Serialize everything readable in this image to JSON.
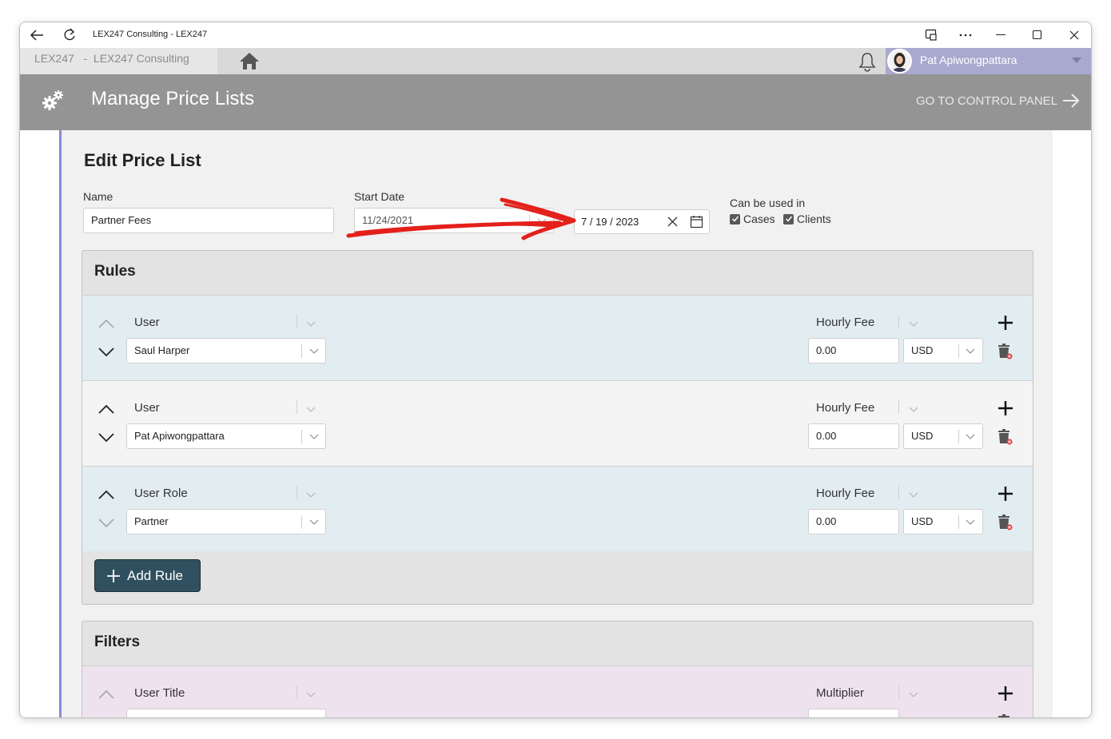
{
  "window": {
    "title": "LEX247 Consulting - LEX247"
  },
  "appbar": {
    "breadcrumb": "LEX247   -  LEX247 Consulting",
    "user_name": "Pat Apiwongpattara"
  },
  "header": {
    "title": "Manage Price Lists",
    "control_panel_link": "GO TO CONTROL PANEL"
  },
  "form": {
    "title": "Edit Price List",
    "name_label": "Name",
    "name_value": "Partner Fees",
    "start_date_label": "Start Date",
    "start_date_value": "11/24/2021",
    "end_date_value": "7 / 19 / 2023",
    "usage_label": "Can be used in",
    "usage_options": [
      {
        "label": "Cases",
        "checked": true
      },
      {
        "label": "Clients",
        "checked": true
      }
    ]
  },
  "rules": {
    "title": "Rules",
    "items": [
      {
        "type_label": "User",
        "value": "Saul Harper",
        "fee_label": "Hourly Fee",
        "fee_value": "0.00",
        "currency": "USD",
        "up_enabled": false,
        "down_enabled": true
      },
      {
        "type_label": "User",
        "value": "Pat Apiwongpattara",
        "fee_label": "Hourly Fee",
        "fee_value": "0.00",
        "currency": "USD",
        "up_enabled": true,
        "down_enabled": true
      },
      {
        "type_label": "User Role",
        "value": "Partner",
        "fee_label": "Hourly Fee",
        "fee_value": "0.00",
        "currency": "USD",
        "up_enabled": true,
        "down_enabled": false
      }
    ],
    "add_button": "Add Rule"
  },
  "filters": {
    "title": "Filters",
    "items": [
      {
        "type_label": "User Title",
        "fee_label": "Multiplier"
      }
    ]
  },
  "colors": {
    "header": "#949494",
    "user_area": "#a9a9cf",
    "panel_accent": "#8a8ad4",
    "rule_blue": "#e2edf2",
    "filter_purple": "#efe2ef",
    "add_button": "#30505f",
    "annotation_arrow": "#e3201b"
  }
}
